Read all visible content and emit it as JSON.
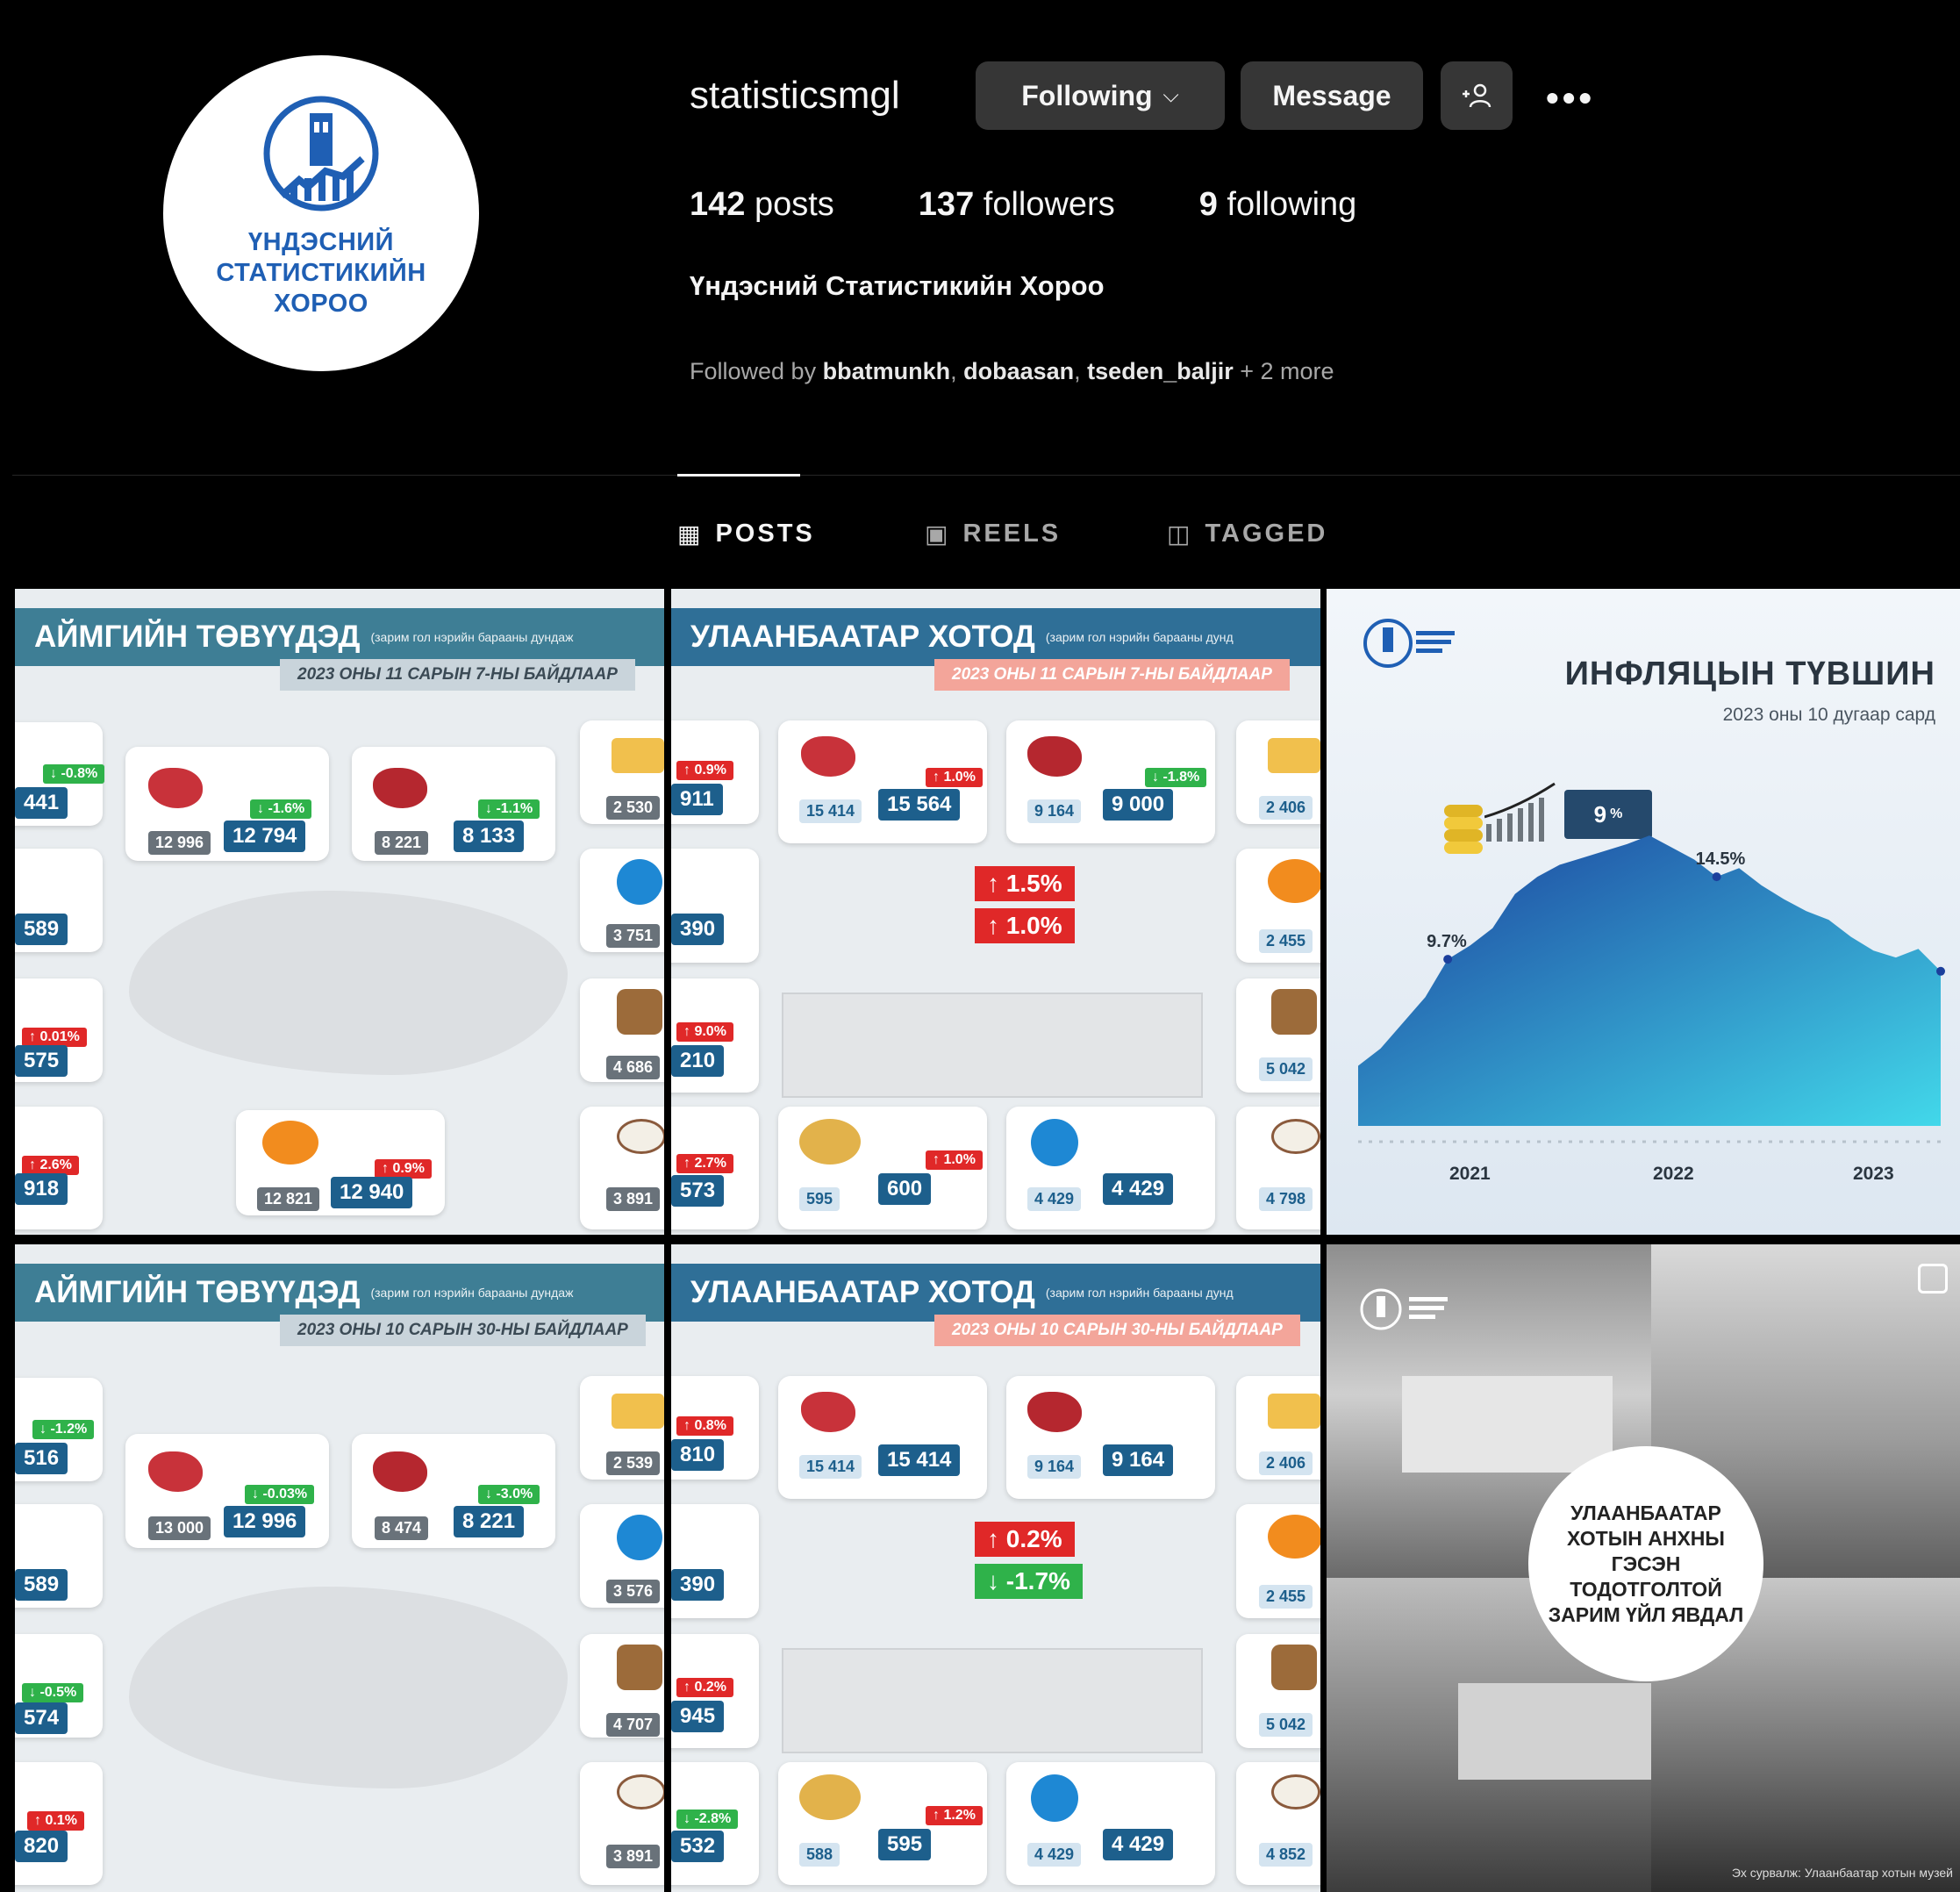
{
  "profile": {
    "username": "statisticsmgl",
    "logo_text": "ҮНДЭСНИЙ СТАТИСТИКИЙН ХОРОО",
    "following_label": "Following",
    "message_label": "Message",
    "posts_count": "142",
    "posts_label": "posts",
    "followers_count": "137",
    "followers_label": "followers",
    "following_count": "9",
    "following_count_label": "following",
    "full_name": "Үндэсний Статистикийн Хороо",
    "followed_by_prefix": "Followed by",
    "followed_by": [
      "bbatmunkh",
      "dobaasan",
      "tseden_baljir"
    ],
    "followed_by_more": "+ 2 more"
  },
  "tabs": [
    {
      "label": "POSTS",
      "icon": "grid-icon",
      "active": true
    },
    {
      "label": "REELS",
      "icon": "reels-icon",
      "active": false
    },
    {
      "label": "TAGGED",
      "icon": "tagged-icon",
      "active": false
    }
  ],
  "posts": {
    "p1": {
      "title": "АЙМГИЙН ТӨВҮҮДЭД",
      "title_small": "(зарим гол нэрийн барааны дундаж",
      "subtitle": "2023 ОНЫ 11 САРЫН 7-НЫ БАЙДЛААР",
      "values": [
        "441",
        "12 996",
        "12 794",
        "8 221",
        "8 133",
        "2 530",
        "589",
        "3 751",
        "575",
        "4 686",
        "918",
        "12 821",
        "12 940",
        "3 891"
      ],
      "changes": [
        "↓ -0.8%",
        "↓ -1.6%",
        "↓ -1.1%",
        "↑ 0.01%",
        "↑ 2.6%",
        "↑ 0.9%"
      ]
    },
    "p2": {
      "title": "УЛААНБААТАР ХОТОД",
      "title_small": "(зарим гол нэрийн барааны дунд",
      "subtitle": "2023 ОНЫ 11 САРЫН 7-НЫ БАЙДЛААР",
      "values": [
        "911",
        "15 414",
        "15 564",
        "9 164",
        "9 000",
        "2 406",
        "390",
        "2 455",
        "210",
        "5 042",
        "573",
        "595",
        "600",
        "4 429",
        "4 429",
        "4 798"
      ],
      "changes": [
        "↑ 0.9%",
        "↑ 1.0%",
        "↓ -1.8%",
        "↑ 9.0%",
        "↑ 2.7%",
        "↑ 1.0%"
      ],
      "tag1": "↑ 1.5%",
      "tag2": "↑ 1.0%"
    },
    "p3": {
      "title": "ИНФЛЯЦЫН ТҮВШИН",
      "subtitle": "2023 оны 10 дугаар сард",
      "current": "9",
      "current_unit": "%"
    },
    "p4": {
      "title": "АЙМГИЙН ТӨВҮҮДЭД",
      "title_small": "(зарим гол нэрийн барааны дундаж",
      "subtitle": "2023 ОНЫ 10 САРЫН 30-НЫ БАЙДЛААР",
      "values": [
        "516",
        "13 000",
        "12 996",
        "8 474",
        "8 221",
        "2 539",
        "589",
        "3 576",
        "574",
        "4 707",
        "820",
        "3 891"
      ],
      "changes": [
        "↓ -1.2%",
        "↓ -0.03%",
        "↓ -3.0%",
        "↓ -0.5%",
        "↑ 0.1%"
      ]
    },
    "p5": {
      "title": "УЛААНБААТАР ХОТОД",
      "title_small": "(зарим гол нэрийн барааны дунд",
      "subtitle": "2023 ОНЫ 10 САРЫН 30-НЫ БАЙДЛААР",
      "values": [
        "810",
        "15 414",
        "15 414",
        "9 164",
        "9 164",
        "2 406",
        "390",
        "2 455",
        "945",
        "5 042",
        "532",
        "588",
        "595",
        "4 429",
        "4 429",
        "4 852"
      ],
      "changes": [
        "↑ 0.8%",
        "↑ 0.2%",
        "↓ -2.8%",
        "↑ 1.2%"
      ],
      "tag1": "↑ 0.2%",
      "tag2": "↓ -1.7%"
    },
    "p6": {
      "circle_text": "УЛААНБААТАР ХОТЫН АНХНЫ ГЭСЭН ТОДОТГОЛТОЙ ЗАРИМ ҮЙЛ ЯВДАЛ",
      "source": "Эх сурвалж: Улаанбаатар хотын музей"
    }
  },
  "chart_data": {
    "type": "area",
    "title": "ИНФЛЯЦЫН ТҮВШИН",
    "subtitle": "2023 оны 10 дугаар сард",
    "x_tick_labels": [
      "2021",
      "2022",
      "2023"
    ],
    "y": [
      3.5,
      4.5,
      6.0,
      7.5,
      9.7,
      10.5,
      11.5,
      13.5,
      14.5,
      15.2,
      15.6,
      16.0,
      16.4,
      16.9,
      16.2,
      15.5,
      14.5,
      15.0,
      14.0,
      13.2,
      12.5,
      12.0,
      11.0,
      10.2,
      9.8,
      10.3,
      9.0
    ],
    "annotations": [
      {
        "index": 4,
        "label": "9.7%"
      },
      {
        "index": 16,
        "label": "14.5%"
      }
    ],
    "ylim": [
      0,
      19
    ],
    "colors": {
      "top": "#1b3f9c",
      "bottom": "#42d8ea"
    }
  },
  "colors": {
    "background": "#000000",
    "button": "#363636",
    "logo_blue": "#1f5fb4",
    "banner": "#3e7e95"
  }
}
